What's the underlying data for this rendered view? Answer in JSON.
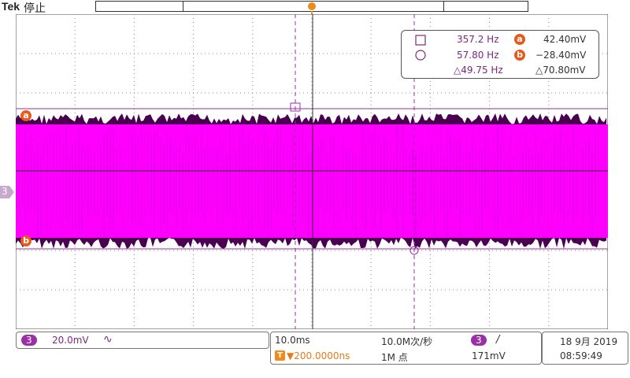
{
  "header": {
    "brand": "Tek",
    "run_state": "停止"
  },
  "trigger_marker": "T",
  "cursor_readout": {
    "row1_freq": "357.2 Hz",
    "row1_badge": "a",
    "row1_value": "42.40mV",
    "row2_freq": "57.80 Hz",
    "row2_badge": "b",
    "row2_value": "−28.40mV",
    "delta_freq": "△49.75 Hz",
    "delta_value": "△70.80mV"
  },
  "cursor_labels": {
    "a": "a",
    "b": "b"
  },
  "channel_marker": "3",
  "channel_panel": {
    "channel": "3",
    "scale": "20.0mV",
    "coupling": "∿"
  },
  "timebase_panel": {
    "time_div": "10.0ms",
    "sample_rate": "10.0M次/秒",
    "trigger_pos": "▼200.0000ns",
    "trigger_tag": "T",
    "record_length": "1M 点"
  },
  "trigger_panel": {
    "channel": "3",
    "slope": "/",
    "level": "171mV"
  },
  "datetime": {
    "date": "18 9月 2019",
    "time": "08:59:49"
  },
  "colors": {
    "trace": "#ff00ff",
    "trace_dark": "#4a0050",
    "accent_orange": "#e85a1c",
    "channel_purple": "#9b2fa5"
  }
}
